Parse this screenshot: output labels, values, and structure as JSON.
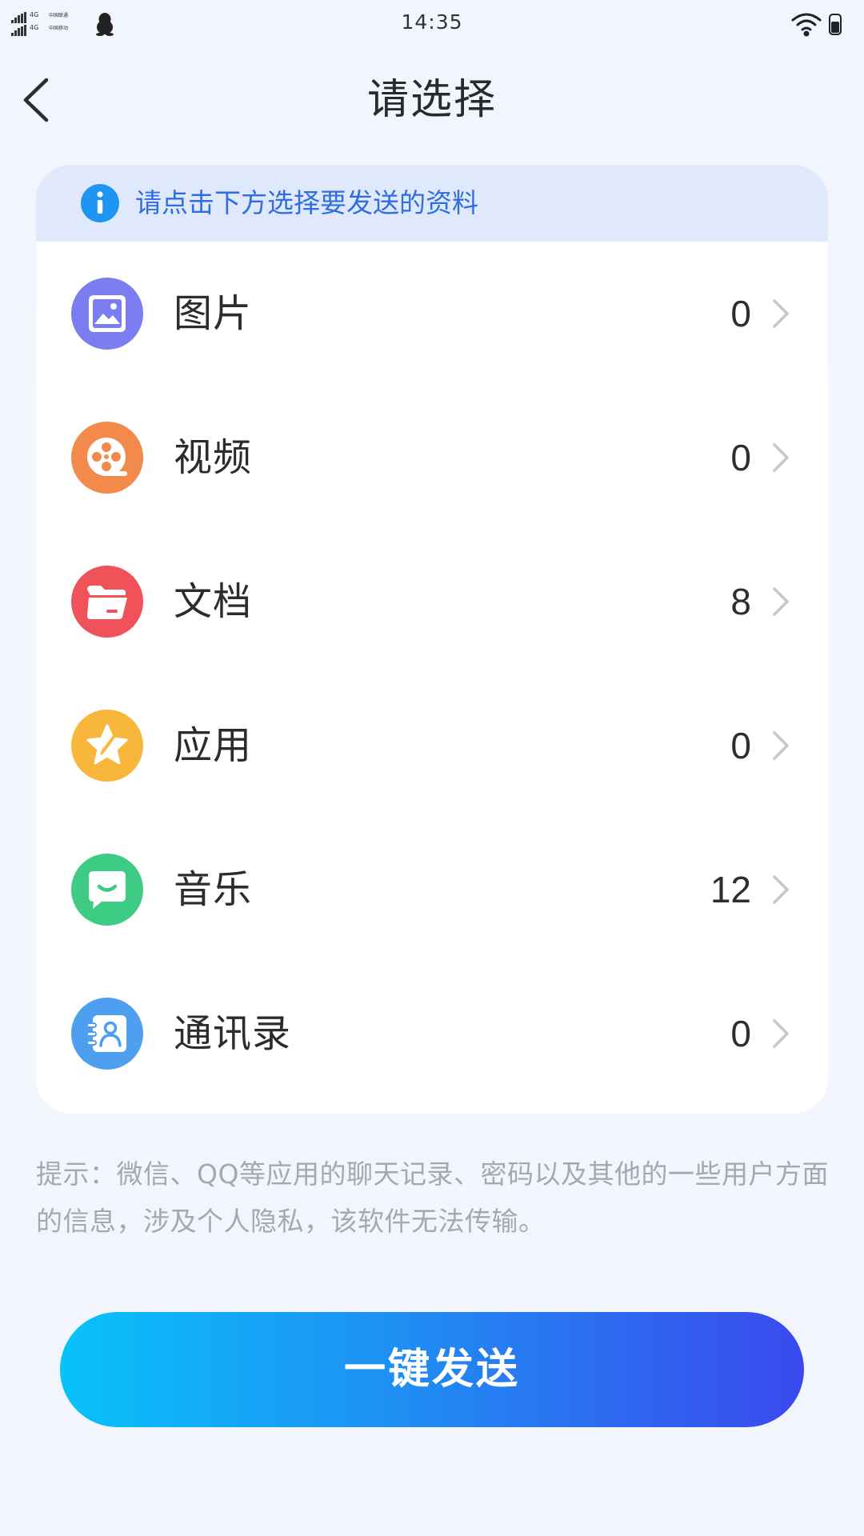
{
  "status_bar": {
    "sim1_network": "4G",
    "sim1_carrier": "中国联通",
    "sim2_network": "4G",
    "sim2_carrier": "中国移动",
    "time": "14:35"
  },
  "header": {
    "title": "请选择"
  },
  "tip": {
    "text": "请点击下方选择要发送的资料",
    "color": "#2f6ee0"
  },
  "items": [
    {
      "label": "图片",
      "count": "0",
      "icon": "image-icon",
      "color": "#7b7ef0"
    },
    {
      "label": "视频",
      "count": "0",
      "icon": "film-reel-icon",
      "color": "#f28a4b"
    },
    {
      "label": "文档",
      "count": "8",
      "icon": "folder-icon",
      "color": "#f0525a"
    },
    {
      "label": "应用",
      "count": "0",
      "icon": "star-pen-icon",
      "color": "#f8b73a"
    },
    {
      "label": "音乐",
      "count": "12",
      "icon": "chat-bubble-icon",
      "color": "#3ecb84"
    },
    {
      "label": "通讯录",
      "count": "0",
      "icon": "contact-card-icon",
      "color": "#4e9ff0"
    }
  ],
  "hint": "提示：微信、QQ等应用的聊天记录、密码以及其他的一些用户方面的信息，涉及个人隐私，该软件无法传输。",
  "send_button": {
    "label": "一键发送"
  },
  "colors": {
    "background": "#f1f5fd",
    "button_gradient_start": "#08c2fa",
    "button_gradient_end": "#3a49ee"
  }
}
